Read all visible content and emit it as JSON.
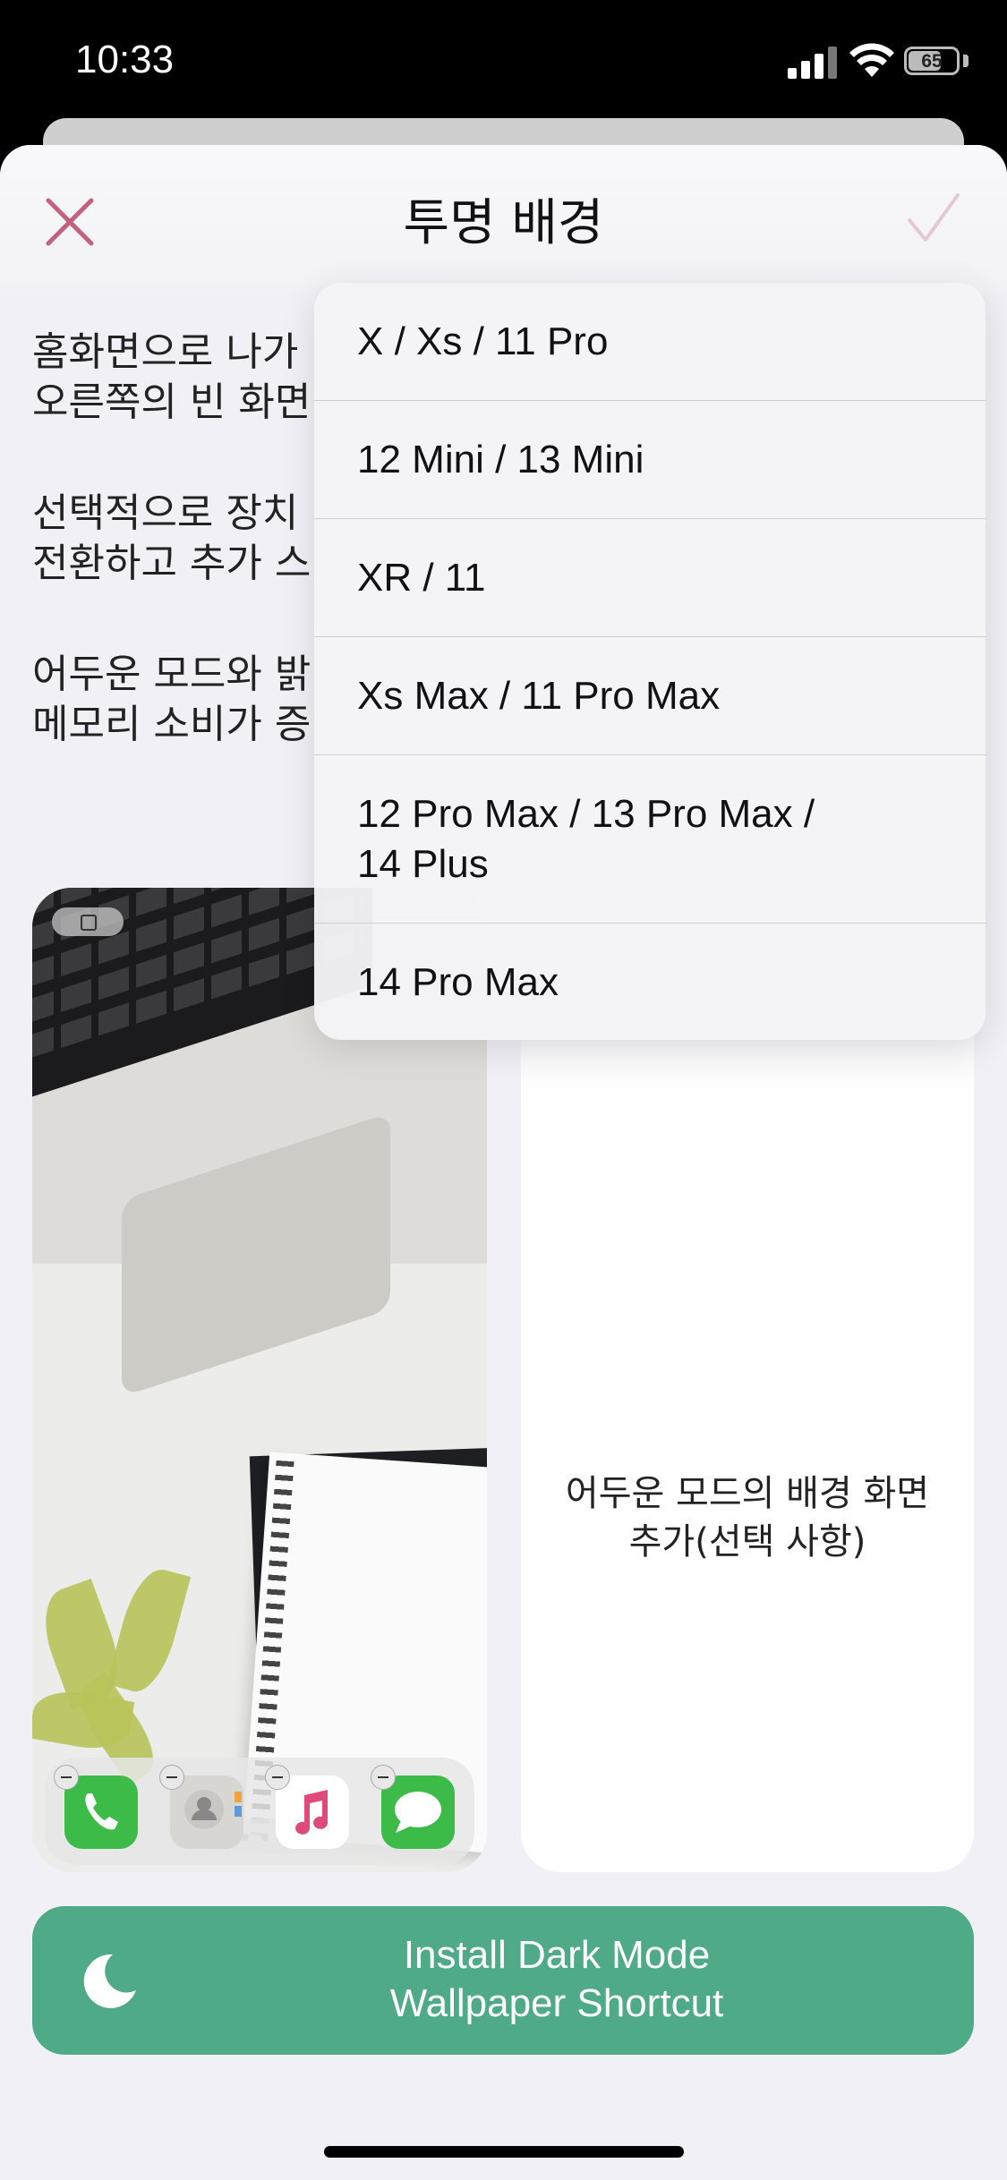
{
  "status_bar": {
    "time": "10:33",
    "battery": "65"
  },
  "header": {
    "title": "투명 배경",
    "close_icon": "close-icon",
    "confirm_icon": "check-icon"
  },
  "description": {
    "line1": "홈화면으로 나가",
    "line2": "오른쪽의 빈 화면",
    "line3": "선택적으로 장치",
    "line4": "전환하고 추가 스",
    "line5": "어두운 모드와 밝",
    "line6": "메모리 소비가 증"
  },
  "dark_card": {
    "line1": "어두운 모드의 배경 화면",
    "line2": "추가(선택 사항)"
  },
  "install_button": {
    "line1": "Install Dark Mode",
    "line2": "Wallpaper Shortcut"
  },
  "device_menu": {
    "items": [
      {
        "label": "X / Xs / 11 Pro"
      },
      {
        "label": "12 Mini / 13 Mini"
      },
      {
        "label": "XR / 11"
      },
      {
        "label": "Xs Max / 11 Pro Max"
      },
      {
        "label": "12 Pro Max / 13 Pro Max /",
        "label2": "14 Plus"
      },
      {
        "label": "14 Pro Max"
      }
    ]
  },
  "colors": {
    "accent_green": "#4faa88",
    "close_pink": "#c2627e",
    "sheet_bg": "#f1f0f6"
  }
}
